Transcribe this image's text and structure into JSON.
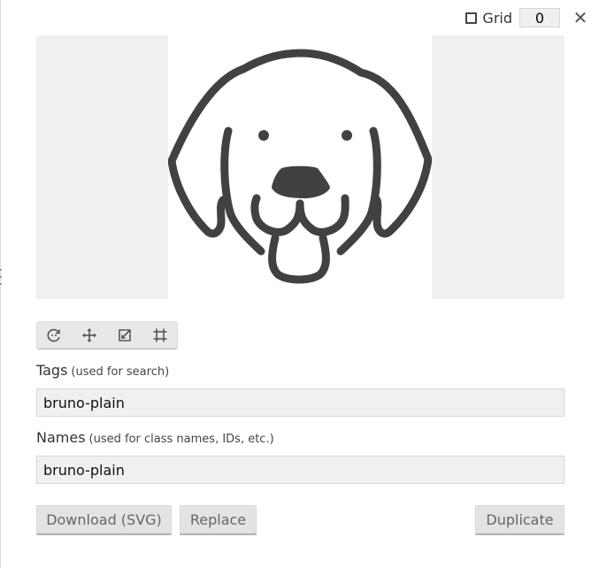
{
  "topbar": {
    "grid_label": "Grid",
    "grid_value": "0",
    "grid_checked": false,
    "close_symbol": "✕"
  },
  "preview": {
    "icon": "dog-face-icon",
    "stroke_color": "#414141"
  },
  "toolbar": {
    "tools": [
      {
        "name": "rotate-icon"
      },
      {
        "name": "move-icon"
      },
      {
        "name": "scale-icon"
      },
      {
        "name": "crop-icon"
      }
    ]
  },
  "tags": {
    "label": "Tags",
    "hint": "(used for search)",
    "value": "bruno-plain"
  },
  "names": {
    "label": "Names",
    "hint": "(used for class names, IDs, etc.)",
    "value": "bruno-plain"
  },
  "buttons": {
    "download": "Download (SVG)",
    "replace": "Replace",
    "duplicate": "Duplicate"
  }
}
